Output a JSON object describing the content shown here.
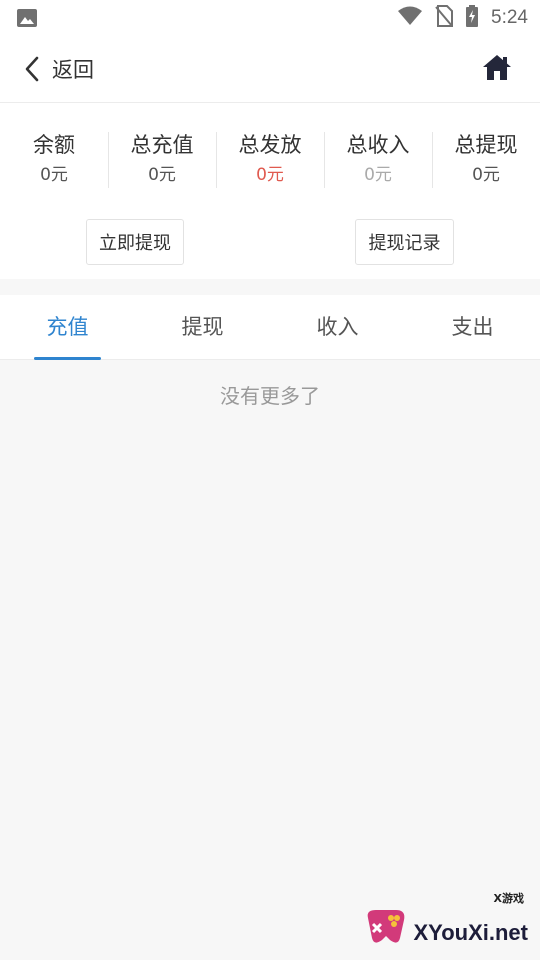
{
  "status_bar": {
    "time": "5:24"
  },
  "nav": {
    "back_label": "返回"
  },
  "stats": [
    {
      "label": "余额",
      "value": "0元",
      "tone": "normal"
    },
    {
      "label": "总充值",
      "value": "0元",
      "tone": "normal"
    },
    {
      "label": "总发放",
      "value": "0元",
      "tone": "red"
    },
    {
      "label": "总收入",
      "value": "0元",
      "tone": "grey"
    },
    {
      "label": "总提现",
      "value": "0元",
      "tone": "normal"
    }
  ],
  "actions": {
    "withdraw_label": "立即提现",
    "records_label": "提现记录"
  },
  "tabs": [
    {
      "label": "充值",
      "active": true
    },
    {
      "label": "提现",
      "active": false
    },
    {
      "label": "收入",
      "active": false
    },
    {
      "label": "支出",
      "active": false
    }
  ],
  "empty_message": "没有更多了",
  "watermark": {
    "small": "X游戏",
    "big": "XYouXi.net"
  },
  "colors": {
    "accent": "#2f84cf",
    "red_value": "#e05a4f",
    "background": "#f7f7f7"
  }
}
